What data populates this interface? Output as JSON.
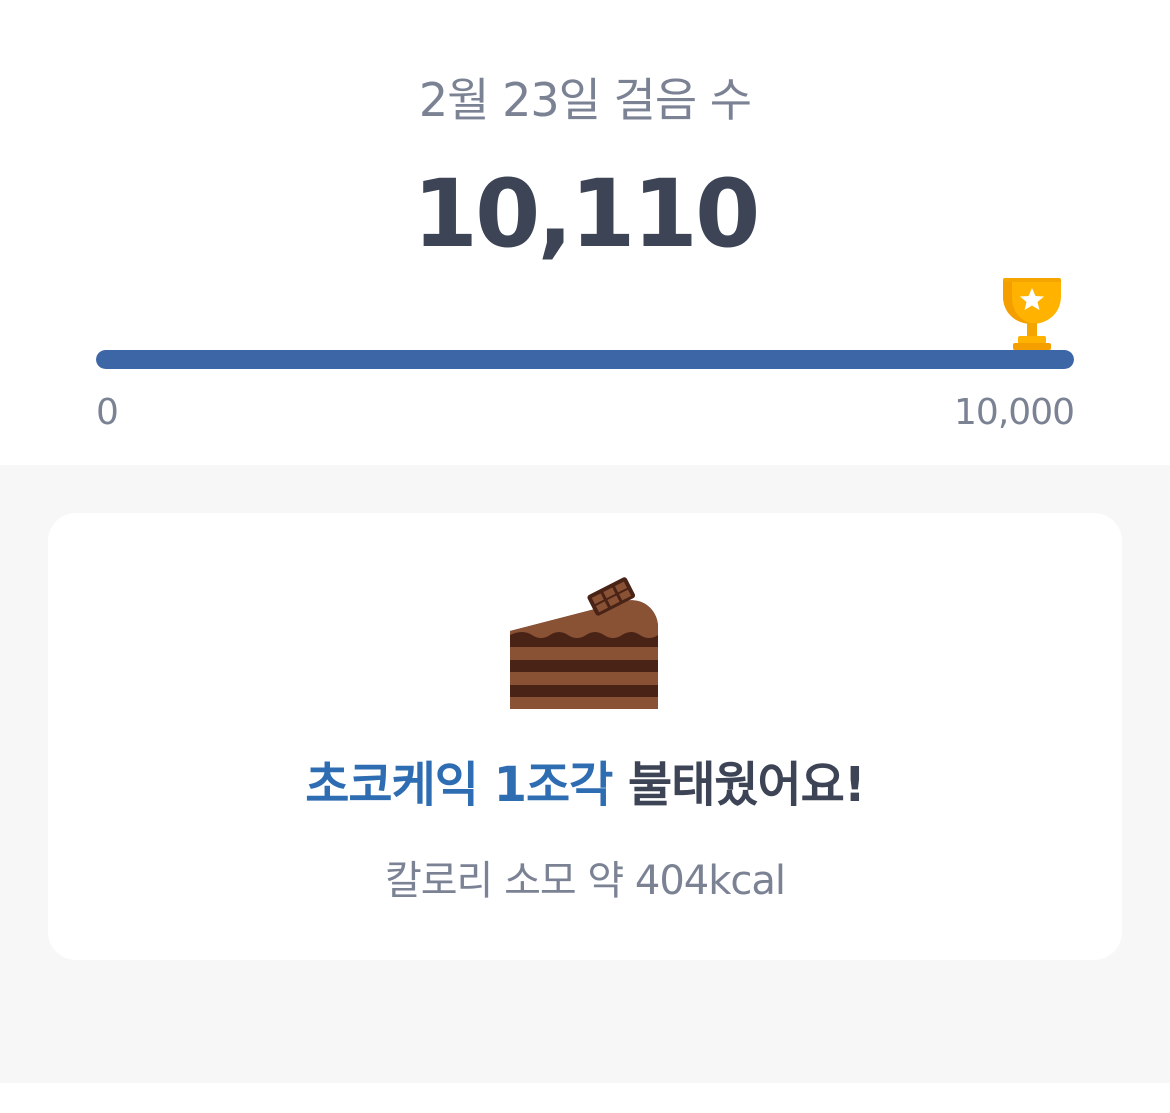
{
  "header": {
    "title": "2월 23일 걸음 수",
    "steps": "10,110"
  },
  "progress": {
    "min_label": "0",
    "max_label": "10,000",
    "current": 10110,
    "goal": 10000,
    "fraction": 1.0,
    "fill_color": "#3c66a6",
    "goal_icon": "trophy-icon"
  },
  "card": {
    "food_icon": "chocolate-cake-icon",
    "food_name": "초코케익 1조각",
    "burn_suffix": " 불태웠어요!",
    "calorie_text": "칼로리 소모 약 404kcal",
    "accent_color": "#2f6db2"
  }
}
